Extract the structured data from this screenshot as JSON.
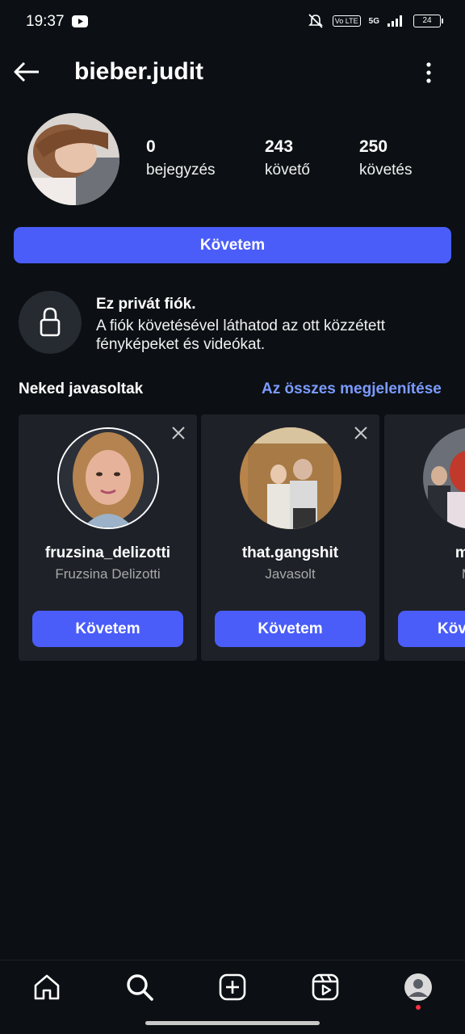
{
  "status_bar": {
    "time": "19:37",
    "volte": "Vo LTE",
    "network": "5G",
    "battery": "24"
  },
  "header": {
    "username": "bieber.judit"
  },
  "profile": {
    "stats": [
      {
        "value": "0",
        "label": "bejegyzés"
      },
      {
        "value": "243",
        "label": "követő"
      },
      {
        "value": "250",
        "label": "követés"
      }
    ],
    "follow_label": "Követem"
  },
  "private": {
    "title": "Ez privát fiók.",
    "description": "A fiók követésével láthatod az ott közzétett fényképeket és videókat."
  },
  "suggestions": {
    "title": "Neked javasoltak",
    "see_all": "Az összes megjelenítése",
    "cards": [
      {
        "username": "fruzsina_delizotti",
        "subtitle": "Fruzsina Delizotti",
        "button": "Követem"
      },
      {
        "username": "that.gangshit",
        "subtitle": "Javasolt",
        "button": "Követem"
      },
      {
        "username": "mate",
        "subtitle": "Mát",
        "button": "Köv"
      }
    ]
  },
  "colors": {
    "background": "#0c1014",
    "accent": "#4a5df9",
    "link": "#7b9bff",
    "card": "#1e2128",
    "notification_dot": "#ff3040"
  },
  "icons": [
    "back-arrow-icon",
    "more-vertical-icon",
    "lock-icon",
    "close-icon",
    "home-icon",
    "search-icon",
    "create-icon",
    "reels-icon",
    "profile-icon"
  ]
}
